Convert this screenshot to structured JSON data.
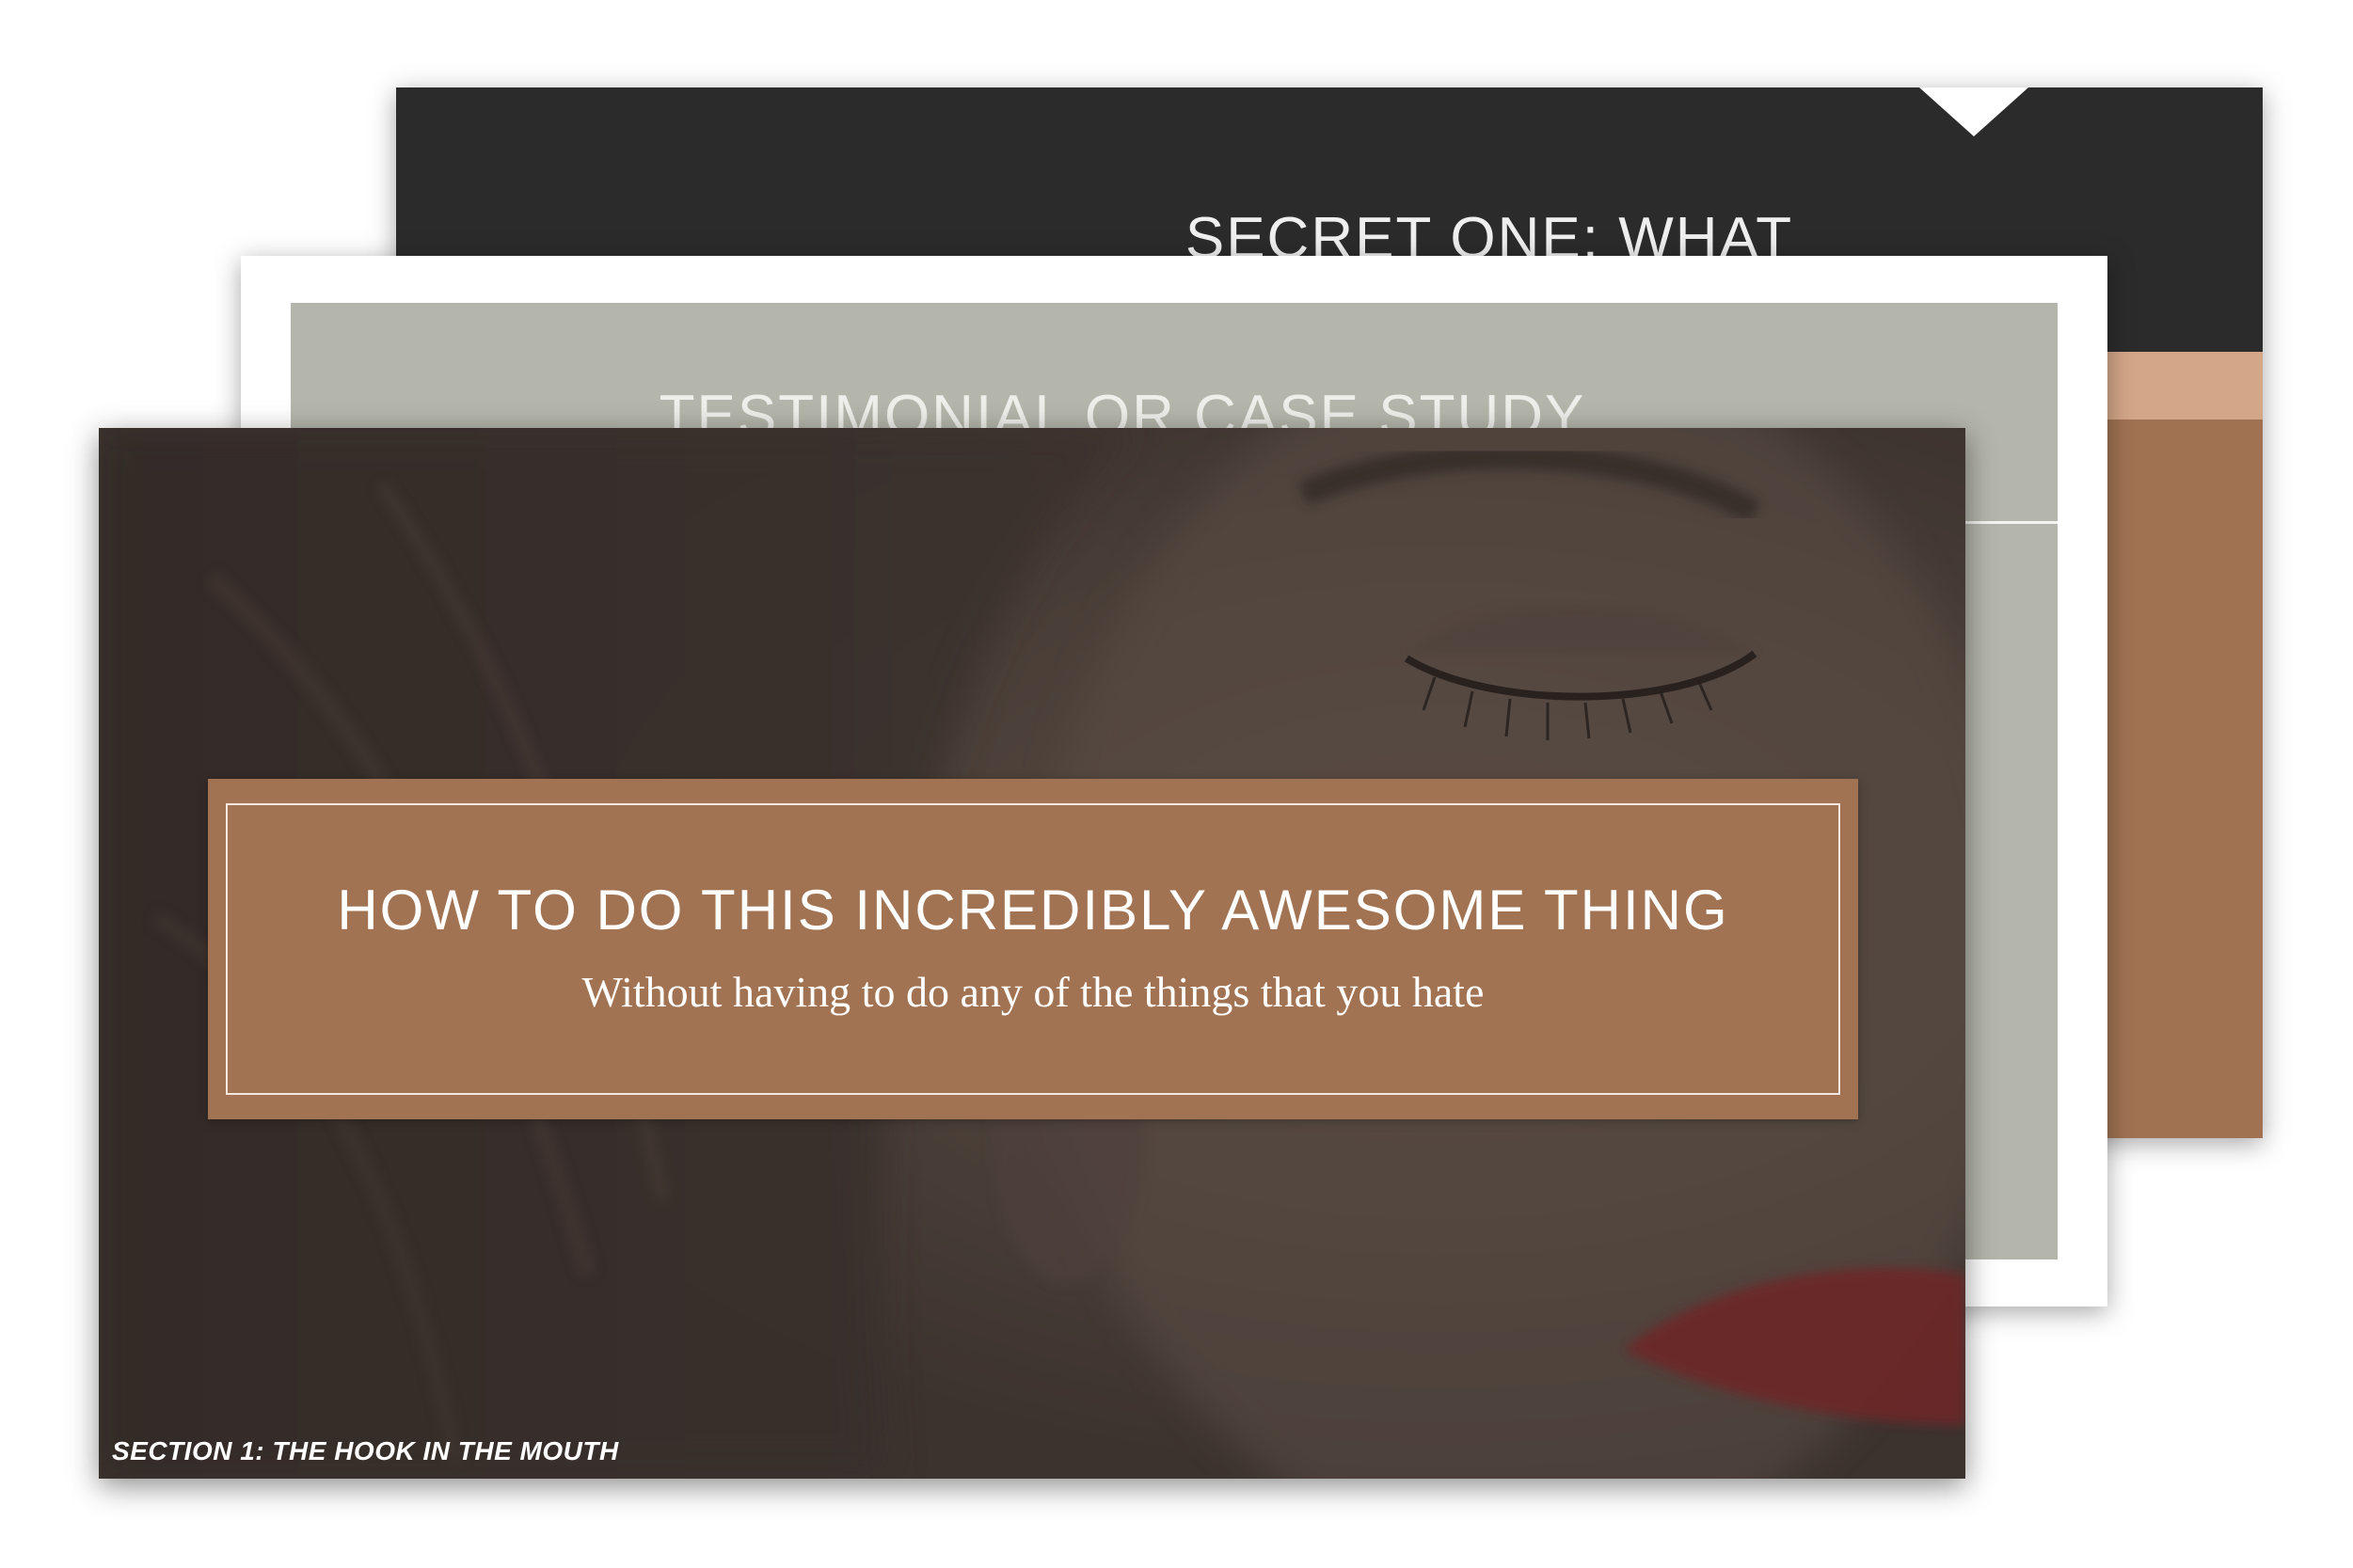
{
  "slides": {
    "back": {
      "heading": "SECRET ONE: WHAT"
    },
    "middle": {
      "heading": "TESTIMONIAL OR CASE STUDY"
    },
    "front": {
      "title": "HOW TO DO THIS INCREDIBLY AWESOME THING",
      "subtitle": "Without having to do any of the things that you hate",
      "section_label": "SECTION 1: THE HOOK IN THE MOUTH",
      "photo_description_icon": "face-photo"
    }
  },
  "colors": {
    "dark_band": "#2b2b2b",
    "peach_stripe": "#d3a688",
    "brown_accent": "#a17352",
    "sage_panel": "#b5b6ab",
    "photo_overlay": "#4a3f3a",
    "lipstick": "#8a2028"
  }
}
